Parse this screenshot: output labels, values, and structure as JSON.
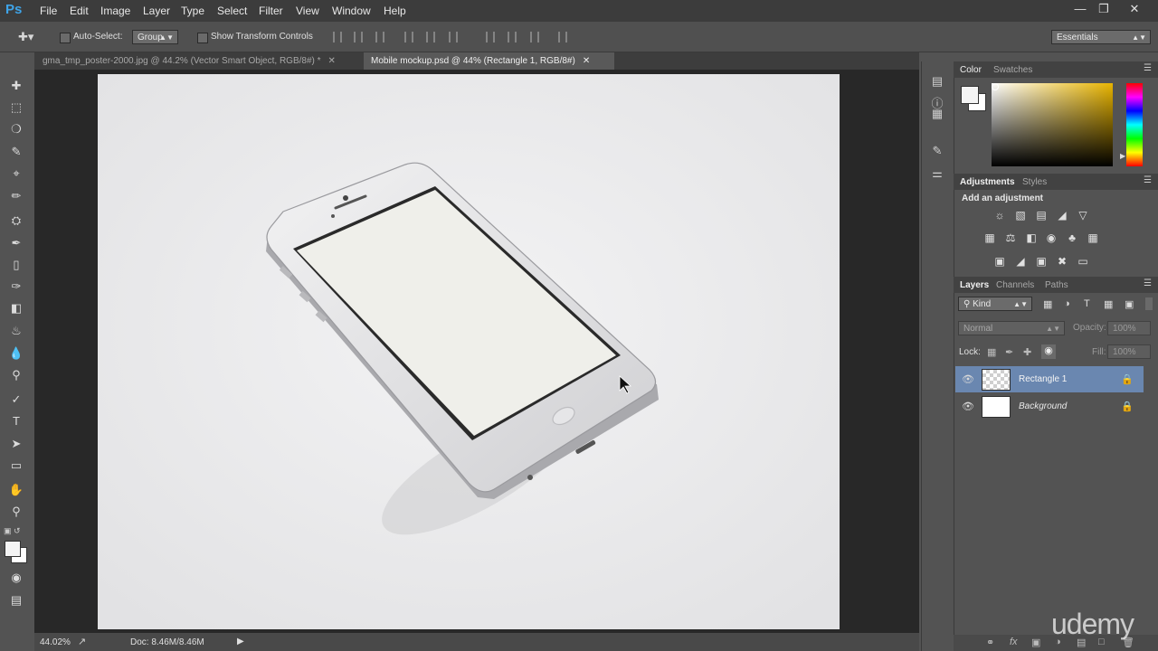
{
  "app": {
    "logo": "Ps",
    "menu": [
      "File",
      "Edit",
      "Image",
      "Layer",
      "Type",
      "Select",
      "Filter",
      "View",
      "Window",
      "Help"
    ],
    "window_controls": [
      "minimize",
      "restore",
      "close"
    ]
  },
  "options_bar": {
    "auto_select_label": "Auto-Select:",
    "auto_select_value": "Group",
    "transform_controls_label": "Show Transform Controls",
    "workspace": "Essentials"
  },
  "tabs": [
    {
      "label": "gma_tmp_poster-2000.jpg @ 44.2% (Vector Smart Object, RGB/8#) *",
      "active": false
    },
    {
      "label": "Mobile mockup.psd @ 44% (Rectangle 1, RGB/8#)",
      "active": true
    }
  ],
  "tools": [
    "move-icon",
    "marquee-icon",
    "lasso-icon",
    "quick-select-icon",
    "crop-icon",
    "eyedropper-icon",
    "healing-icon",
    "brush-icon",
    "clone-stamp-icon",
    "history-brush-icon",
    "eraser-icon",
    "paint-bucket-icon",
    "blur-icon",
    "dodge-icon",
    "pen-icon",
    "type-icon",
    "path-select-icon",
    "rectangle-icon",
    "hand-icon",
    "zoom-icon"
  ],
  "status": {
    "zoom": "44.02%",
    "doc_info": "Doc: 8.46M/8.46M"
  },
  "panels": {
    "color": {
      "tabs": [
        "Color",
        "Swatches"
      ]
    },
    "adjustments": {
      "tabs": [
        "Adjustments",
        "Styles"
      ],
      "heading": "Add an adjustment"
    },
    "layers": {
      "tabs": [
        "Layers",
        "Channels",
        "Paths"
      ],
      "filter_kind": "Kind",
      "blend_mode": "Normal",
      "opacity_label": "Opacity:",
      "opacity_value": "100%",
      "lock_label": "Lock:",
      "fill_label": "Fill:",
      "fill_value": "100%",
      "items": [
        {
          "name": "Rectangle 1",
          "selected": true
        },
        {
          "name": "Background",
          "selected": false
        }
      ]
    }
  },
  "watermark": "udemy",
  "colors": {
    "accent_blue": "#3fa4e8",
    "layer_selected": "#6a87b0",
    "canvas": "#e9e9ea"
  }
}
